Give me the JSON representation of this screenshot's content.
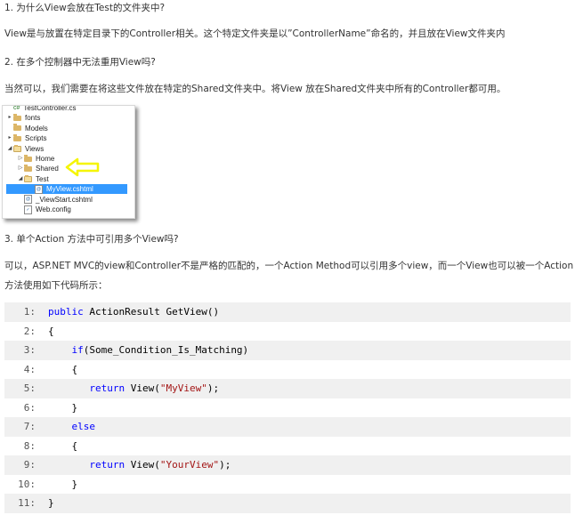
{
  "article": {
    "q1": "1. 为什么View会放在Test的文件夹中?",
    "a1": "View是与放置在特定目录下的Controller相关。这个特定文件夹是以”ControllerName”命名的，并且放在View文件夹内",
    "q2": "2. 在多个控制器中无法重用View吗?",
    "a2": "当然可以，我们需要在将这些文件放在特定的Shared文件夹中。将View 放在Shared文件夹中所有的Controller都可用。",
    "q3": "3. 单个Action 方法中可引用多个View吗?",
    "a3": "可以，ASP.NET MVC的view和Controller不是严格的匹配的，一个Action Method可以引用多个view，而一个View也可以被一个Action方法使用如下代码所示："
  },
  "solution_explorer": {
    "items": [
      {
        "label": "TestController.cs",
        "icon": "csharp-file-icon",
        "expander": "",
        "indent": 0
      },
      {
        "label": "fonts",
        "icon": "folder-icon",
        "expander": "▸",
        "indent": 0
      },
      {
        "label": "Models",
        "icon": "folder-icon",
        "expander": "",
        "indent": 0
      },
      {
        "label": "Scripts",
        "icon": "folder-icon",
        "expander": "▸",
        "indent": 0
      },
      {
        "label": "Views",
        "icon": "open-folder-icon",
        "expander": "◢",
        "indent": 0
      },
      {
        "label": "Home",
        "icon": "folder-icon",
        "expander": "▷",
        "indent": 1
      },
      {
        "label": "Shared",
        "icon": "folder-icon",
        "expander": "▷",
        "indent": 1
      },
      {
        "label": "Test",
        "icon": "open-folder-icon",
        "expander": "◢",
        "indent": 1
      },
      {
        "label": "MyView.cshtml",
        "icon": "cshtml-file-icon",
        "expander": "",
        "indent": 2,
        "selected": true
      },
      {
        "label": "_ViewStart.cshtml",
        "icon": "cshtml-file-icon",
        "expander": "",
        "indent": 1
      },
      {
        "label": "Web.config",
        "icon": "config-file-icon",
        "expander": "",
        "indent": 1
      }
    ],
    "highlight_arrow_color": "#f5f500"
  },
  "code_block": {
    "lines": [
      {
        "n": "1:",
        "text": "public ActionResult GetView()"
      },
      {
        "n": "2:",
        "text": "{"
      },
      {
        "n": "3:",
        "text": "    if(Some_Condition_Is_Matching)"
      },
      {
        "n": "4:",
        "text": "    {"
      },
      {
        "n": "5:",
        "text": "       return View(\"MyView\");"
      },
      {
        "n": "6:",
        "text": "    }"
      },
      {
        "n": "7:",
        "text": "    else"
      },
      {
        "n": "8:",
        "text": "    {"
      },
      {
        "n": "9:",
        "text": "       return View(\"YourView\");"
      },
      {
        "n": "10:",
        "text": "    }"
      },
      {
        "n": "11:",
        "text": "}"
      }
    ],
    "colors": {
      "keyword": "#0000ff",
      "string": "#a31515",
      "stripe": "#f0f0f0"
    }
  }
}
